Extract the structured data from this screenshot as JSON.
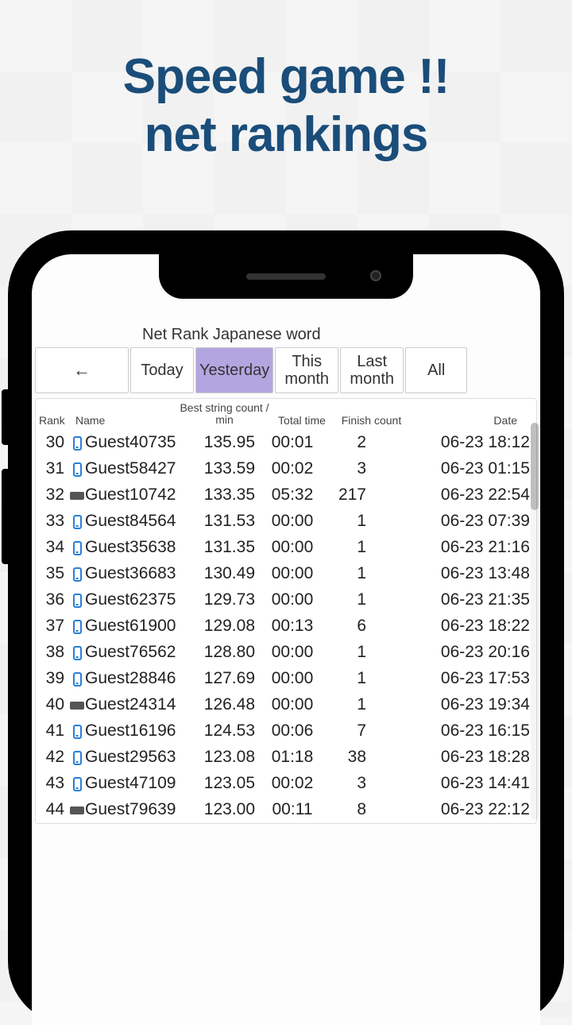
{
  "headline_line1": "Speed game !!",
  "headline_line2": "net rankings",
  "app_title": "Net Rank Japanese word",
  "back_arrow": "←",
  "tabs": {
    "today": "Today",
    "yesterday": "Yesterday",
    "this_month": "This month",
    "last_month": "Last month",
    "all": "All",
    "selected": "yesterday"
  },
  "columns": {
    "rank": "Rank",
    "name": "Name",
    "best": "Best string count / min",
    "total": "Total time",
    "finish": "Finish count",
    "date": "Date"
  },
  "rows": [
    {
      "rank": 30,
      "icon": "phone",
      "name": "Guest40735",
      "best": "135.95",
      "total": "00:01",
      "finish": 2,
      "date": "06-23 18:12"
    },
    {
      "rank": 31,
      "icon": "phone",
      "name": "Guest58427",
      "best": "133.59",
      "total": "00:02",
      "finish": 3,
      "date": "06-23 01:15"
    },
    {
      "rank": 32,
      "icon": "keyboard",
      "name": "Guest10742",
      "best": "133.35",
      "total": "05:32",
      "finish": 217,
      "date": "06-23 22:54"
    },
    {
      "rank": 33,
      "icon": "phone",
      "name": "Guest84564",
      "best": "131.53",
      "total": "00:00",
      "finish": 1,
      "date": "06-23 07:39"
    },
    {
      "rank": 34,
      "icon": "phone",
      "name": "Guest35638",
      "best": "131.35",
      "total": "00:00",
      "finish": 1,
      "date": "06-23 21:16"
    },
    {
      "rank": 35,
      "icon": "phone",
      "name": "Guest36683",
      "best": "130.49",
      "total": "00:00",
      "finish": 1,
      "date": "06-23 13:48"
    },
    {
      "rank": 36,
      "icon": "phone",
      "name": "Guest62375",
      "best": "129.73",
      "total": "00:00",
      "finish": 1,
      "date": "06-23 21:35"
    },
    {
      "rank": 37,
      "icon": "phone",
      "name": "Guest61900",
      "best": "129.08",
      "total": "00:13",
      "finish": 6,
      "date": "06-23 18:22"
    },
    {
      "rank": 38,
      "icon": "phone",
      "name": "Guest76562",
      "best": "128.80",
      "total": "00:00",
      "finish": 1,
      "date": "06-23 20:16"
    },
    {
      "rank": 39,
      "icon": "phone",
      "name": "Guest28846",
      "best": "127.69",
      "total": "00:00",
      "finish": 1,
      "date": "06-23 17:53"
    },
    {
      "rank": 40,
      "icon": "keyboard",
      "name": "Guest24314",
      "best": "126.48",
      "total": "00:00",
      "finish": 1,
      "date": "06-23 19:34"
    },
    {
      "rank": 41,
      "icon": "phone",
      "name": "Guest16196",
      "best": "124.53",
      "total": "00:06",
      "finish": 7,
      "date": "06-23 16:15"
    },
    {
      "rank": 42,
      "icon": "phone",
      "name": "Guest29563",
      "best": "123.08",
      "total": "01:18",
      "finish": 38,
      "date": "06-23 18:28"
    },
    {
      "rank": 43,
      "icon": "phone",
      "name": "Guest47109",
      "best": "123.05",
      "total": "00:02",
      "finish": 3,
      "date": "06-23 14:41"
    },
    {
      "rank": 44,
      "icon": "keyboard",
      "name": "Guest79639",
      "best": "123.00",
      "total": "00:11",
      "finish": 8,
      "date": "06-23 22:12"
    }
  ]
}
